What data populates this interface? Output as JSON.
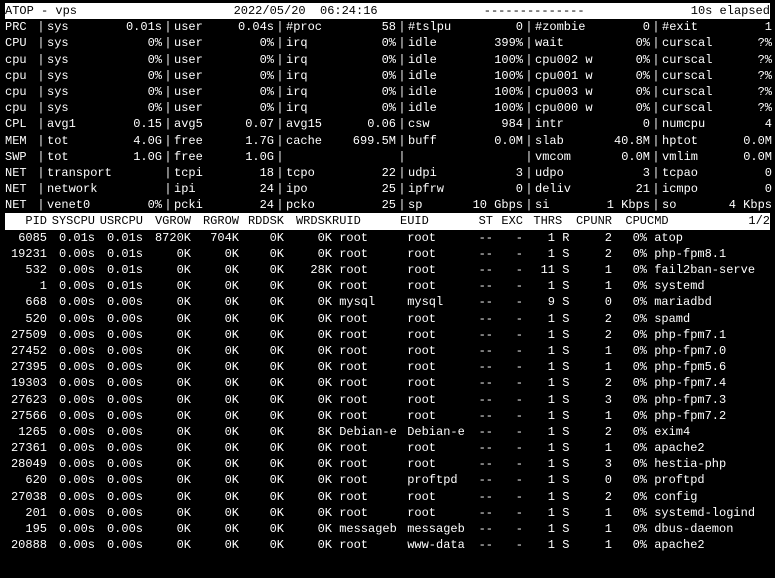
{
  "header": {
    "left": "ATOP - vps       ",
    "center": "2022/05/20  06:24:16",
    "dash": "--------------",
    "right": "10s elapsed"
  },
  "sysrows": [
    {
      "label": "PRC",
      "c1": "sys",
      "v1": "0.01s",
      "c2": "user",
      "v2": "0.04s",
      "c3": "#proc",
      "v3": "58",
      "c4": "#tslpu",
      "v4": "0",
      "c5": "#zombie",
      "v5": "0",
      "c6": "#exit",
      "v6": "1"
    },
    {
      "label": "CPU",
      "c1": "sys",
      "v1": "0%",
      "c2": "user",
      "v2": "0%",
      "c3": "irq",
      "v3": "0%",
      "c4": "idle",
      "v4": "399%",
      "c5": "wait",
      "v5": "0%",
      "c6": "curscal",
      "v6": "?%"
    },
    {
      "label": "cpu",
      "c1": "sys",
      "v1": "0%",
      "c2": "user",
      "v2": "0%",
      "c3": "irq",
      "v3": "0%",
      "c4": "idle",
      "v4": "100%",
      "c5": "cpu002 w",
      "v5": "0%",
      "c6": "curscal",
      "v6": "?%"
    },
    {
      "label": "cpu",
      "c1": "sys",
      "v1": "0%",
      "c2": "user",
      "v2": "0%",
      "c3": "irq",
      "v3": "0%",
      "c4": "idle",
      "v4": "100%",
      "c5": "cpu001 w",
      "v5": "0%",
      "c6": "curscal",
      "v6": "?%"
    },
    {
      "label": "cpu",
      "c1": "sys",
      "v1": "0%",
      "c2": "user",
      "v2": "0%",
      "c3": "irq",
      "v3": "0%",
      "c4": "idle",
      "v4": "100%",
      "c5": "cpu003 w",
      "v5": "0%",
      "c6": "curscal",
      "v6": "?%"
    },
    {
      "label": "cpu",
      "c1": "sys",
      "v1": "0%",
      "c2": "user",
      "v2": "0%",
      "c3": "irq",
      "v3": "0%",
      "c4": "idle",
      "v4": "100%",
      "c5": "cpu000 w",
      "v5": "0%",
      "c6": "curscal",
      "v6": "?%"
    },
    {
      "label": "CPL",
      "c1": "avg1",
      "v1": "0.15",
      "c2": "avg5",
      "v2": "0.07",
      "c3": "avg15",
      "v3": "0.06",
      "c4": "csw",
      "v4": "984",
      "c5": "intr",
      "v5": "0",
      "c6": "numcpu",
      "v6": "4"
    },
    {
      "label": "MEM",
      "c1": "tot",
      "v1": "4.0G",
      "c2": "free",
      "v2": "1.7G",
      "c3": "cache",
      "v3": "699.5M",
      "c4": "buff",
      "v4": "0.0M",
      "c5": "slab",
      "v5": "40.8M",
      "c6": "hptot",
      "v6": "0.0M"
    },
    {
      "label": "SWP",
      "c1": "tot",
      "v1": "1.0G",
      "c2": "free",
      "v2": "1.0G",
      "c3": "",
      "v3": "",
      "c4": "",
      "v4": "",
      "c5": "vmcom",
      "v5": "0.0M",
      "c6": "vmlim",
      "v6": "0.0M"
    },
    {
      "label": "NET",
      "c1": "transport",
      "v1": "",
      "c2": "tcpi",
      "v2": "18",
      "c3": "tcpo",
      "v3": "22",
      "c4": "udpi",
      "v4": "3",
      "c5": "udpo",
      "v5": "3",
      "c6": "tcpao",
      "v6": "0"
    },
    {
      "label": "NET",
      "c1": "network",
      "v1": "",
      "c2": "ipi",
      "v2": "24",
      "c3": "ipo",
      "v3": "25",
      "c4": "ipfrw",
      "v4": "0",
      "c5": "deliv",
      "v5": "21",
      "c6": "icmpo",
      "v6": "0"
    },
    {
      "label": "NET",
      "c1": "venet0",
      "v1": "0%",
      "c2": "pcki",
      "v2": "24",
      "c3": "pcko",
      "v3": "25",
      "c4": "sp",
      "v4": "10 Gbps",
      "c5": "si",
      "v5": "1 Kbps",
      "c6": "so",
      "v6": "4 Kbps"
    }
  ],
  "proc_header": {
    "pid": "PID",
    "syscpu": "SYSCPU",
    "usrcpu": "USRCPU",
    "vgrow": "VGROW",
    "rgrow": "RGROW",
    "rddsk": "RDDSK",
    "wrdsk": "WRDSK",
    "ruid": "RUID",
    "euid": "EUID",
    "st": "ST",
    "exc": "EXC",
    "thr": "THR",
    "s": "S",
    "cpunr": "CPUNR",
    "cpu": "CPU",
    "cmd": "CMD",
    "page": "1/2"
  },
  "procs": [
    {
      "pid": "6085",
      "syscpu": "0.01s",
      "usrcpu": "0.01s",
      "vgrow": "8720K",
      "rgrow": "704K",
      "rddsk": "0K",
      "wrdsk": "0K",
      "ruid": "root",
      "euid": "root",
      "st": "--",
      "exc": "-",
      "thr": "1",
      "s": "R",
      "cpunr": "2",
      "cpu": "0%",
      "cmd": "atop"
    },
    {
      "pid": "19231",
      "syscpu": "0.00s",
      "usrcpu": "0.01s",
      "vgrow": "0K",
      "rgrow": "0K",
      "rddsk": "0K",
      "wrdsk": "0K",
      "ruid": "root",
      "euid": "root",
      "st": "--",
      "exc": "-",
      "thr": "1",
      "s": "S",
      "cpunr": "2",
      "cpu": "0%",
      "cmd": "php-fpm8.1"
    },
    {
      "pid": "532",
      "syscpu": "0.00s",
      "usrcpu": "0.01s",
      "vgrow": "0K",
      "rgrow": "0K",
      "rddsk": "0K",
      "wrdsk": "28K",
      "ruid": "root",
      "euid": "root",
      "st": "--",
      "exc": "-",
      "thr": "11",
      "s": "S",
      "cpunr": "1",
      "cpu": "0%",
      "cmd": "fail2ban-serve"
    },
    {
      "pid": "1",
      "syscpu": "0.00s",
      "usrcpu": "0.01s",
      "vgrow": "0K",
      "rgrow": "0K",
      "rddsk": "0K",
      "wrdsk": "0K",
      "ruid": "root",
      "euid": "root",
      "st": "--",
      "exc": "-",
      "thr": "1",
      "s": "S",
      "cpunr": "1",
      "cpu": "0%",
      "cmd": "systemd"
    },
    {
      "pid": "668",
      "syscpu": "0.00s",
      "usrcpu": "0.00s",
      "vgrow": "0K",
      "rgrow": "0K",
      "rddsk": "0K",
      "wrdsk": "0K",
      "ruid": "mysql",
      "euid": "mysql",
      "st": "--",
      "exc": "-",
      "thr": "9",
      "s": "S",
      "cpunr": "0",
      "cpu": "0%",
      "cmd": "mariadbd"
    },
    {
      "pid": "520",
      "syscpu": "0.00s",
      "usrcpu": "0.00s",
      "vgrow": "0K",
      "rgrow": "0K",
      "rddsk": "0K",
      "wrdsk": "0K",
      "ruid": "root",
      "euid": "root",
      "st": "--",
      "exc": "-",
      "thr": "1",
      "s": "S",
      "cpunr": "2",
      "cpu": "0%",
      "cmd": "spamd"
    },
    {
      "pid": "27509",
      "syscpu": "0.00s",
      "usrcpu": "0.00s",
      "vgrow": "0K",
      "rgrow": "0K",
      "rddsk": "0K",
      "wrdsk": "0K",
      "ruid": "root",
      "euid": "root",
      "st": "--",
      "exc": "-",
      "thr": "1",
      "s": "S",
      "cpunr": "2",
      "cpu": "0%",
      "cmd": "php-fpm7.1"
    },
    {
      "pid": "27452",
      "syscpu": "0.00s",
      "usrcpu": "0.00s",
      "vgrow": "0K",
      "rgrow": "0K",
      "rddsk": "0K",
      "wrdsk": "0K",
      "ruid": "root",
      "euid": "root",
      "st": "--",
      "exc": "-",
      "thr": "1",
      "s": "S",
      "cpunr": "1",
      "cpu": "0%",
      "cmd": "php-fpm7.0"
    },
    {
      "pid": "27395",
      "syscpu": "0.00s",
      "usrcpu": "0.00s",
      "vgrow": "0K",
      "rgrow": "0K",
      "rddsk": "0K",
      "wrdsk": "0K",
      "ruid": "root",
      "euid": "root",
      "st": "--",
      "exc": "-",
      "thr": "1",
      "s": "S",
      "cpunr": "1",
      "cpu": "0%",
      "cmd": "php-fpm5.6"
    },
    {
      "pid": "19303",
      "syscpu": "0.00s",
      "usrcpu": "0.00s",
      "vgrow": "0K",
      "rgrow": "0K",
      "rddsk": "0K",
      "wrdsk": "0K",
      "ruid": "root",
      "euid": "root",
      "st": "--",
      "exc": "-",
      "thr": "1",
      "s": "S",
      "cpunr": "2",
      "cpu": "0%",
      "cmd": "php-fpm7.4"
    },
    {
      "pid": "27623",
      "syscpu": "0.00s",
      "usrcpu": "0.00s",
      "vgrow": "0K",
      "rgrow": "0K",
      "rddsk": "0K",
      "wrdsk": "0K",
      "ruid": "root",
      "euid": "root",
      "st": "--",
      "exc": "-",
      "thr": "1",
      "s": "S",
      "cpunr": "3",
      "cpu": "0%",
      "cmd": "php-fpm7.3"
    },
    {
      "pid": "27566",
      "syscpu": "0.00s",
      "usrcpu": "0.00s",
      "vgrow": "0K",
      "rgrow": "0K",
      "rddsk": "0K",
      "wrdsk": "0K",
      "ruid": "root",
      "euid": "root",
      "st": "--",
      "exc": "-",
      "thr": "1",
      "s": "S",
      "cpunr": "1",
      "cpu": "0%",
      "cmd": "php-fpm7.2"
    },
    {
      "pid": "1265",
      "syscpu": "0.00s",
      "usrcpu": "0.00s",
      "vgrow": "0K",
      "rgrow": "0K",
      "rddsk": "0K",
      "wrdsk": "8K",
      "ruid": "Debian-e",
      "euid": "Debian-e",
      "st": "--",
      "exc": "-",
      "thr": "1",
      "s": "S",
      "cpunr": "2",
      "cpu": "0%",
      "cmd": "exim4"
    },
    {
      "pid": "27361",
      "syscpu": "0.00s",
      "usrcpu": "0.00s",
      "vgrow": "0K",
      "rgrow": "0K",
      "rddsk": "0K",
      "wrdsk": "0K",
      "ruid": "root",
      "euid": "root",
      "st": "--",
      "exc": "-",
      "thr": "1",
      "s": "S",
      "cpunr": "1",
      "cpu": "0%",
      "cmd": "apache2"
    },
    {
      "pid": "28049",
      "syscpu": "0.00s",
      "usrcpu": "0.00s",
      "vgrow": "0K",
      "rgrow": "0K",
      "rddsk": "0K",
      "wrdsk": "0K",
      "ruid": "root",
      "euid": "root",
      "st": "--",
      "exc": "-",
      "thr": "1",
      "s": "S",
      "cpunr": "3",
      "cpu": "0%",
      "cmd": "hestia-php"
    },
    {
      "pid": "620",
      "syscpu": "0.00s",
      "usrcpu": "0.00s",
      "vgrow": "0K",
      "rgrow": "0K",
      "rddsk": "0K",
      "wrdsk": "0K",
      "ruid": "root",
      "euid": "proftpd",
      "st": "--",
      "exc": "-",
      "thr": "1",
      "s": "S",
      "cpunr": "0",
      "cpu": "0%",
      "cmd": "proftpd"
    },
    {
      "pid": "27038",
      "syscpu": "0.00s",
      "usrcpu": "0.00s",
      "vgrow": "0K",
      "rgrow": "0K",
      "rddsk": "0K",
      "wrdsk": "0K",
      "ruid": "root",
      "euid": "root",
      "st": "--",
      "exc": "-",
      "thr": "1",
      "s": "S",
      "cpunr": "2",
      "cpu": "0%",
      "cmd": "config"
    },
    {
      "pid": "201",
      "syscpu": "0.00s",
      "usrcpu": "0.00s",
      "vgrow": "0K",
      "rgrow": "0K",
      "rddsk": "0K",
      "wrdsk": "0K",
      "ruid": "root",
      "euid": "root",
      "st": "--",
      "exc": "-",
      "thr": "1",
      "s": "S",
      "cpunr": "1",
      "cpu": "0%",
      "cmd": "systemd-logind"
    },
    {
      "pid": "195",
      "syscpu": "0.00s",
      "usrcpu": "0.00s",
      "vgrow": "0K",
      "rgrow": "0K",
      "rddsk": "0K",
      "wrdsk": "0K",
      "ruid": "messageb",
      "euid": "messageb",
      "st": "--",
      "exc": "-",
      "thr": "1",
      "s": "S",
      "cpunr": "1",
      "cpu": "0%",
      "cmd": "dbus-daemon"
    },
    {
      "pid": "20888",
      "syscpu": "0.00s",
      "usrcpu": "0.00s",
      "vgrow": "0K",
      "rgrow": "0K",
      "rddsk": "0K",
      "wrdsk": "0K",
      "ruid": "root",
      "euid": "www-data",
      "st": "--",
      "exc": "-",
      "thr": "1",
      "s": "S",
      "cpunr": "1",
      "cpu": "0%",
      "cmd": "apache2"
    }
  ]
}
